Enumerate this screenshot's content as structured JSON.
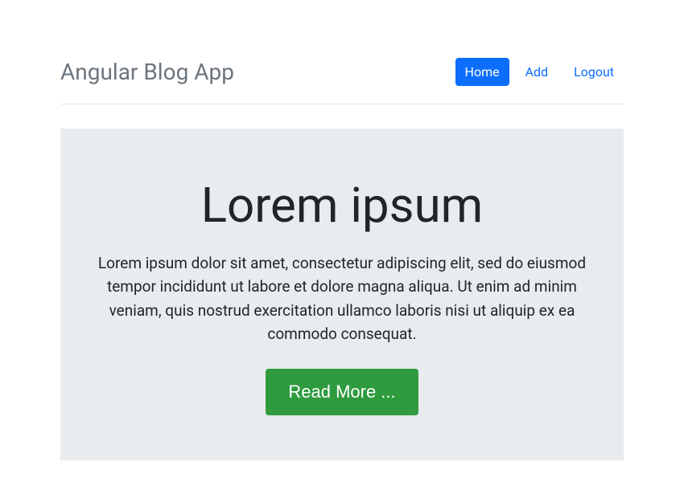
{
  "header": {
    "brand": "Angular Blog App",
    "nav": {
      "home": "Home",
      "add": "Add",
      "logout": "Logout"
    }
  },
  "post": {
    "title": "Lorem ipsum",
    "body": "Lorem ipsum dolor sit amet, consectetur adipiscing elit, sed do eiusmod tempor incididunt ut labore et dolore magna aliqua. Ut enim ad minim veniam, quis nostrud exercitation ullamco laboris nisi ut aliquip ex ea commodo consequat.",
    "read_more_label": "Read More ..."
  }
}
